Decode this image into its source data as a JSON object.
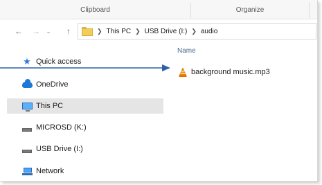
{
  "ribbon": {
    "groups": [
      "Clipboard",
      "Organize"
    ]
  },
  "navbar": {
    "back_icon": "back-arrow-icon",
    "forward_icon": "forward-arrow-icon",
    "recent_icon": "chevron-down-icon",
    "up_icon": "up-arrow-icon",
    "breadcrumbs": [
      "This PC",
      "USB Drive (I:)",
      "audio"
    ]
  },
  "sidebar": {
    "items": [
      {
        "label": "Quick access",
        "icon": "star-icon"
      },
      {
        "label": "OneDrive",
        "icon": "cloud-icon"
      },
      {
        "label": "This PC",
        "icon": "monitor-icon",
        "selected": true
      },
      {
        "label": "MICROSD (K:)",
        "icon": "drive-icon"
      },
      {
        "label": "USB Drive (I:)",
        "icon": "drive-icon"
      },
      {
        "label": "Network",
        "icon": "network-icon"
      }
    ]
  },
  "content": {
    "column_header": "Name",
    "files": [
      {
        "name": "background music.mp3",
        "icon": "vlc-icon"
      }
    ]
  },
  "annotation": {
    "arrow_color": "#2f5fa8"
  }
}
